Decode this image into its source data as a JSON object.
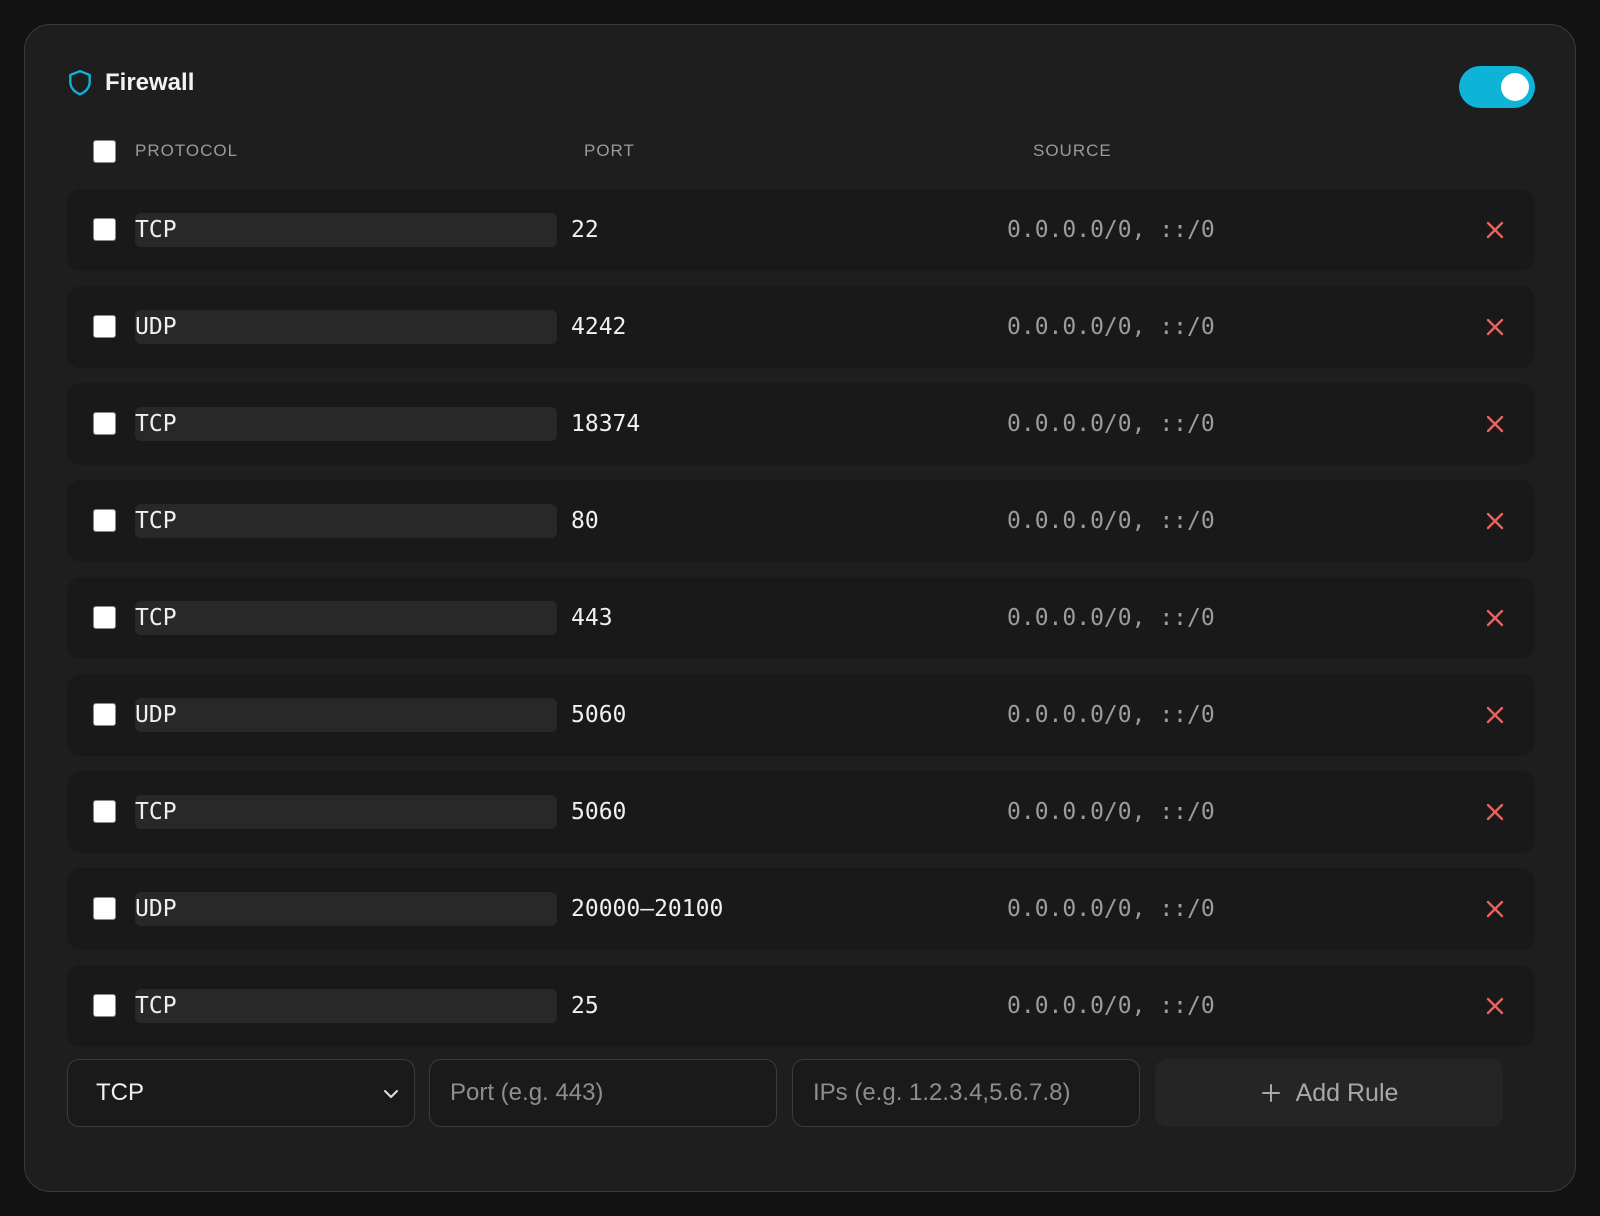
{
  "header": {
    "title": "Firewall",
    "enabled": true,
    "accent_color": "#0db4d8"
  },
  "columns": {
    "protocol": "PROTOCOL",
    "port": "PORT",
    "source": "SOURCE"
  },
  "rules": [
    {
      "protocol": "TCP",
      "port": "22",
      "source": "0.0.0.0/0, ::/0"
    },
    {
      "protocol": "UDP",
      "port": "4242",
      "source": "0.0.0.0/0, ::/0"
    },
    {
      "protocol": "TCP",
      "port": "18374",
      "source": "0.0.0.0/0, ::/0"
    },
    {
      "protocol": "TCP",
      "port": "80",
      "source": "0.0.0.0/0, ::/0"
    },
    {
      "protocol": "TCP",
      "port": "443",
      "source": "0.0.0.0/0, ::/0"
    },
    {
      "protocol": "UDP",
      "port": "5060",
      "source": "0.0.0.0/0, ::/0"
    },
    {
      "protocol": "TCP",
      "port": "5060",
      "source": "0.0.0.0/0, ::/0"
    },
    {
      "protocol": "UDP",
      "port": "20000–20100",
      "source": "0.0.0.0/0, ::/0"
    },
    {
      "protocol": "TCP",
      "port": "25",
      "source": "0.0.0.0/0, ::/0"
    }
  ],
  "add_form": {
    "protocol_value": "TCP",
    "port_placeholder": "Port (e.g. 443)",
    "ips_placeholder": "IPs (e.g. 1.2.3.4,5.6.7.8)",
    "add_label": "Add Rule"
  },
  "colors": {
    "delete": "#e8625e",
    "toggle_on": "#0db4d8"
  },
  "icons": {
    "header": "shield-icon",
    "delete": "close-icon",
    "select": "chevron-down-icon",
    "add": "plus-icon"
  }
}
